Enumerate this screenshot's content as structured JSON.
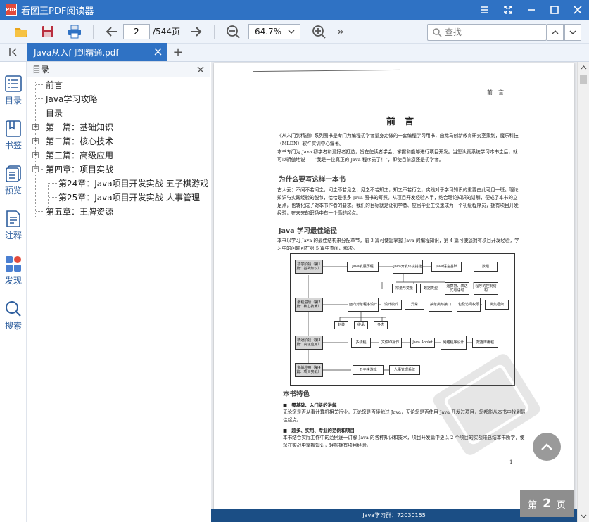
{
  "app": {
    "logo_text": "PDF",
    "title": "看图王PDF阅读器"
  },
  "toolbar": {
    "current_page": "2",
    "total_pages": "/544页",
    "zoom": "64.7%",
    "more": "»",
    "search_placeholder": "查找"
  },
  "tabs": [
    {
      "label": "Java从入门到精通.pdf"
    }
  ],
  "new_tab": "+",
  "rail": [
    {
      "label": "目录",
      "icon": "list-icon"
    },
    {
      "label": "书签",
      "icon": "bookmark-icon"
    },
    {
      "label": "预览",
      "icon": "thumbnails-icon"
    },
    {
      "label": "注释",
      "icon": "note-icon"
    },
    {
      "label": "发现",
      "icon": "apps-icon"
    },
    {
      "label": "搜索",
      "icon": "search-icon"
    }
  ],
  "outline": {
    "header": "目录",
    "items": [
      {
        "label": "前言"
      },
      {
        "label": "Java学习攻略"
      },
      {
        "label": "目录"
      },
      {
        "label": "第一篇：基础知识",
        "expander": "+"
      },
      {
        "label": "第二篇：核心技术",
        "expander": "+"
      },
      {
        "label": "第三篇：高级应用",
        "expander": "+"
      },
      {
        "label": "第四章：项目实战",
        "expander": "−"
      },
      {
        "label": "第24章：Java项目开发实战-五子棋游戏"
      },
      {
        "label": "第25章：Java项目开发实战-人事管理"
      },
      {
        "label": "第五章：王牌资源"
      }
    ]
  },
  "page": {
    "header": "前　言",
    "title": "前　言",
    "intro": "《从入门到精通》系列图书是专门为编程初学者量身定做的一套编程学习用书，由龙马创新教育研究室策划，魔乐科技（MLDN）软件实训中心编著。",
    "intro2": "本书专门为 Java 初学者和爱好者打造，旨在使读者学会、掌握和能够进行项目开发。当您认真系统学习本书之后，就可以骄傲地说——“我是一位真正的 Java 程序员了！”，即使目前您还是初学者。",
    "h_why": "为什么要写这样一本书",
    "why_text": "古人云：不闻不若闻之，闻之不若见之，见之不若知之，知之不若行之。实践对于学习知识的重要由此可见一斑。理论知识与实践经验的脱节，恰恰是很多 Java 图书的写照。从项目开发经验入手，结合理论知识的讲解，便成了本书的立足点，也转化成了对本书作者的要求。我们的目标就是让初学者、应届毕业生快速成为一个初级程序员，拥有项目开发经验，在未来的职场中有一个高的起点。",
    "h_path": "Java 学习最佳途径",
    "path_text": "本书以学习 Java 的最佳结构来分配章节，前 3 篇可使您掌握 Java 的编程知识，第 4 篇可使您拥有项目开发经验，学习中的问题可在第 5 篇中查阅、解决。",
    "flow": {
      "stages": [
        "初学阶段（第1篇：基础知识）",
        "编程进阶（第2篇：核心技术）",
        "精通阶段（第3篇：高级应用）",
        "实战应用（第4篇：项目实战）"
      ],
      "row1": [
        "Java发展历程",
        "Java开发环境搭建",
        "Java语言基础",
        "数组"
      ],
      "row1b": [
        "常量与变量",
        "数据类型",
        "运算符、表达式与语句",
        "程序的控制结构"
      ],
      "row2": [
        "面向对象程序设计",
        "设计模式",
        "异常",
        "抽象类与接口",
        "包及访问权限",
        "类集框架"
      ],
      "row2b": [
        "封装",
        "继承",
        "多态"
      ],
      "row3": [
        "多线程",
        "文件IO操作",
        "Java Applet",
        "网络程序设计",
        "数据库编程"
      ],
      "row4": [
        "五子棋游戏",
        "人事管理系统"
      ]
    },
    "h_feature": "本书特色",
    "b1": "■　零基础、入门级的讲解",
    "b1_text": "无论您是否从事计算机相关行业，无论您是否接触过 Java，无论您是否使用 Java 开发过项目，您都能从本书中找到最佳起点。",
    "b2": "■　超多、实用、专业的范例和项目",
    "b2_text": "本书结合实际工作中的范例逐一讲解 Java 的各种知识和技术，项目开发篇中更以 2 个项目的实战来总结本书所学，使您在实战中掌握知识，轻松拥有项目经验。",
    "page_number": "1",
    "footer": "Java学习群：72030155"
  },
  "badge": {
    "prefix": "第",
    "number": "2",
    "suffix": "页"
  }
}
